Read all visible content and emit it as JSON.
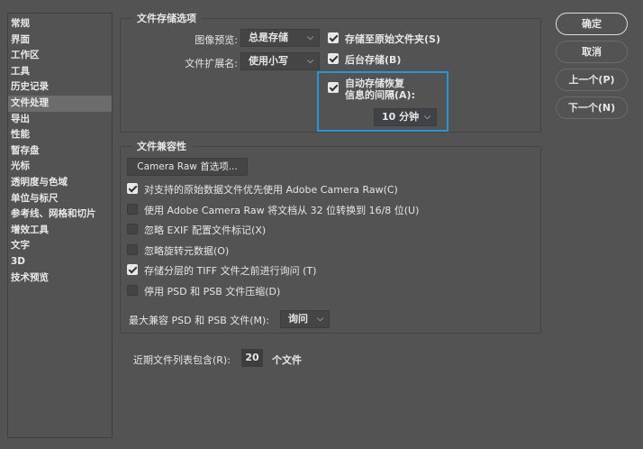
{
  "sidebar": {
    "items": [
      "常规",
      "界面",
      "工作区",
      "工具",
      "历史记录",
      "文件处理",
      "导出",
      "性能",
      "暂存盘",
      "光标",
      "透明度与色域",
      "单位与标尺",
      "参考线、网格和切片",
      "增效工具",
      "文字",
      "3D",
      "技术预览"
    ],
    "selected": "文件处理"
  },
  "save_options": {
    "title": "文件存储选项",
    "image_preview_label": "图像预览:",
    "image_preview_value": "总是存储",
    "extension_label": "文件扩展名:",
    "extension_value": "使用小写",
    "save_to_original": "存储至原始文件夹(S)",
    "background_save": "后台存储(B)",
    "autosave_line1": "自动存储恢复",
    "autosave_line2": "信息的间隔(A):",
    "autosave_value": "10 分钟"
  },
  "compat": {
    "title": "文件兼容性",
    "camera_raw_button": "Camera Raw 首选项...",
    "options": [
      {
        "label": "对支持的原始数据文件优先使用 Adobe Camera Raw(C)",
        "checked": true
      },
      {
        "label": "使用 Adobe Camera Raw 将文档从 32 位转换到 16/8 位(U)",
        "checked": false
      },
      {
        "label": "忽略 EXIF 配置文件标记(X)",
        "checked": false
      },
      {
        "label": "忽略旋转元数据(O)",
        "checked": false
      },
      {
        "label": "存储分层的 TIFF 文件之前进行询问 (T)",
        "checked": true
      },
      {
        "label": "停用 PSD 和 PSB 文件压缩(D)",
        "checked": false
      }
    ],
    "max_compat_label": "最大兼容 PSD 和 PSB 文件(M):",
    "max_compat_value": "询问"
  },
  "recent": {
    "label": "近期文件列表包含(R):",
    "value": "20",
    "suffix": "个文件"
  },
  "buttons": {
    "ok": "确定",
    "cancel": "取消",
    "prev": "上一个(P)",
    "next": "下一个(N)"
  },
  "colors": {
    "background": "#535353",
    "highlight": "#2a95d2"
  }
}
